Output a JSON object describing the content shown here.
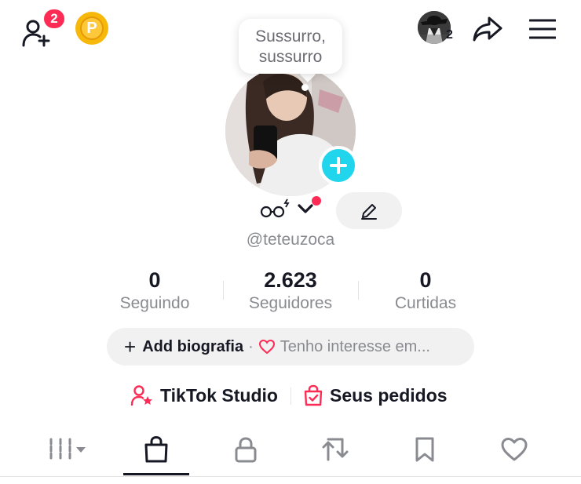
{
  "topbar": {
    "add_friend_icon": "add-friend-icon",
    "notification_count": "2",
    "coin_letter": "P",
    "story_count": "2",
    "share_icon": "share-icon",
    "menu_icon": "hamburger-menu-icon"
  },
  "bubble": {
    "text": "Sussurro, sussurro"
  },
  "profile": {
    "display_name_glyph": "oo",
    "username": "@teteuzoca",
    "avatar_add_icon": "plus-icon",
    "edit_icon": "pencil-icon"
  },
  "stats": [
    {
      "value": "0",
      "label": "Seguindo"
    },
    {
      "value": "2.623",
      "label": "Seguidores"
    },
    {
      "value": "0",
      "label": "Curtidas"
    }
  ],
  "bio": {
    "plus": "+",
    "add_label": "Add biografia",
    "separator": "·",
    "interest_label": "Tenho interesse em..."
  },
  "links": {
    "studio_label": "TikTok Studio",
    "orders_label": "Seus pedidos"
  },
  "tabs": [
    {
      "icon": "grid-icon"
    },
    {
      "icon": "shopping-bag-icon",
      "active": true
    },
    {
      "icon": "lock-icon"
    },
    {
      "icon": "repost-icon"
    },
    {
      "icon": "bookmark-icon"
    },
    {
      "icon": "heart-icon"
    }
  ],
  "colors": {
    "accent_red": "#fe2c55",
    "accent_cyan": "#20d5ec",
    "text_primary": "#161823",
    "text_secondary": "#8a8b91",
    "pill_bg": "#f1f1f2"
  }
}
